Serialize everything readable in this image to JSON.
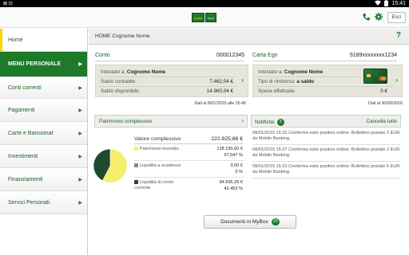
{
  "status": {
    "time": "15:41",
    "left_text": "⊠  ⊡"
  },
  "topbar": {
    "logo_text_1": "credem",
    "logo_text_2": "banca",
    "exit_label": "Esci"
  },
  "sidebar": {
    "items": [
      {
        "label": "Home"
      },
      {
        "label": "MENU PERSONALE"
      },
      {
        "label": "Conti correnti"
      },
      {
        "label": "Pagamenti"
      },
      {
        "label": "Carte e Bancomat"
      },
      {
        "label": "Investimenti"
      },
      {
        "label": "Finanziamenti"
      },
      {
        "label": "Servizi Personali"
      }
    ]
  },
  "breadcrumb": {
    "text": "HOME Cognome Nome",
    "help": "?"
  },
  "conto": {
    "title": "Conto",
    "number": "000012345",
    "intestato_label": "Intestato a:",
    "intestato_value": "Cognome Nome",
    "saldo_contabile_label": "Saldo contabile:",
    "saldo_contabile_value": "7.462,04 €",
    "saldo_disponibile_label": "Saldo disponibile:",
    "saldo_disponibile_value": "14.960,04 €",
    "date": "Dati al 8/01/2015 alle 15:40"
  },
  "carta": {
    "title": "Carta Ego",
    "number": "5189xxxxxxxx1234",
    "intestato_label": "Intestato a:",
    "intestato_value": "Cognome Nome",
    "rimborso_label": "Tipo di rimborso:",
    "rimborso_value": "a saldo",
    "spese_label": "Spese effettuate",
    "spese_value": "0 €",
    "date": "Dati al 30/09/2016"
  },
  "patrimonio": {
    "bar_label": "Patrimonio complessivo",
    "valore_label": "Valore complessivo",
    "valore_value": "222.825,86 €",
    "items": [
      {
        "label": "Patrimonio investito",
        "value": "128.230,60 €",
        "pct": "57,547 %",
        "color": "#f5ef6a"
      },
      {
        "label": "Liquidità a scadenza",
        "value": "0,00 €",
        "pct": "0 %",
        "color": "#888888"
      },
      {
        "label": "Liquidità di conto corrente",
        "value": "94.595,26 €",
        "pct": "42,453 %",
        "color": "#1e4a30"
      }
    ]
  },
  "chart_data": {
    "type": "pie",
    "categories": [
      "Patrimonio investito",
      "Liquidità a scadenza",
      "Liquidità di conto corrente"
    ],
    "values": [
      57.547,
      0,
      42.453
    ],
    "colors": [
      "#f5ef6a",
      "#888888",
      "#1e4a30"
    ]
  },
  "notifiche": {
    "label": "Notifiche",
    "count": "3",
    "clear_label": "Cancella tutte",
    "items": [
      {
        "text": "08/01/2015 15:31 Conferma esito positivo ordine: Bollettino postale 2 EUR da Mobile Banking."
      },
      {
        "text": "08/01/2015 15:27 Conferma esito positivo ordine: Bollettino postale 2 EUR da Mobile Banking."
      },
      {
        "text": "08/01/2015 15:23 Conferma esito positivo ordine: Bollettino postale 5 EUR da Mobile Banking."
      }
    ]
  },
  "mybox": {
    "label": "Documenti in MyBox",
    "count": "20"
  }
}
